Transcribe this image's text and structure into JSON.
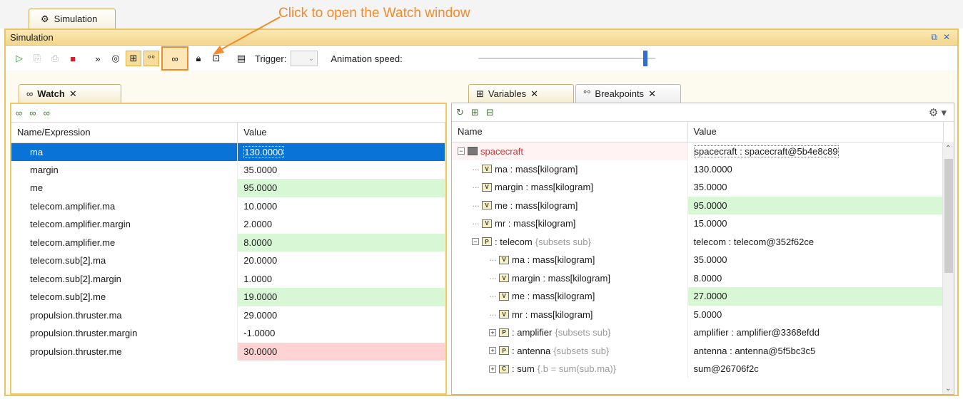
{
  "top_tab": {
    "label": "Simulation"
  },
  "annotation": {
    "text": "Click to open the Watch window"
  },
  "title_bar": {
    "title": "Simulation",
    "restore": "⧉",
    "close": "✕"
  },
  "toolbar": {
    "trigger_label": "Trigger:",
    "animation_label": "Animation speed:"
  },
  "watch": {
    "tab_label": "Watch",
    "tab_close": "✕",
    "columns": [
      "Name/Expression",
      "Value"
    ],
    "rows": [
      {
        "name": "ma",
        "value": "130.0000"
      },
      {
        "name": "margin",
        "value": "35.0000"
      },
      {
        "name": "me",
        "value": "95.0000"
      },
      {
        "name": "telecom.amplifier.ma",
        "value": "10.0000"
      },
      {
        "name": "telecom.amplifier.margin",
        "value": "2.0000"
      },
      {
        "name": "telecom.amplifier.me",
        "value": "8.0000"
      },
      {
        "name": "telecom.sub[2].ma",
        "value": "20.0000"
      },
      {
        "name": "telecom.sub[2].margin",
        "value": "1.0000"
      },
      {
        "name": "telecom.sub[2].me",
        "value": "19.0000"
      },
      {
        "name": "propulsion.thruster.ma",
        "value": "29.0000"
      },
      {
        "name": "propulsion.thruster.margin",
        "value": "-1.0000"
      },
      {
        "name": "propulsion.thruster.me",
        "value": "30.0000"
      }
    ]
  },
  "variables": {
    "tab_label": "Variables",
    "tab_close": "✕",
    "breakpoints_label": "Breakpoints",
    "breakpoints_close": "✕",
    "columns": [
      "Name",
      "Value"
    ],
    "rows": [
      {
        "name": "spacecraft",
        "sub": "",
        "value": "spacecraft : spacecraft@5b4e8c89"
      },
      {
        "name": "ma : mass[kilogram]",
        "sub": "",
        "value": "130.0000"
      },
      {
        "name": "margin : mass[kilogram]",
        "sub": "",
        "value": "35.0000"
      },
      {
        "name": "me : mass[kilogram]",
        "sub": "",
        "value": "95.0000"
      },
      {
        "name": "mr : mass[kilogram]",
        "sub": "",
        "value": "15.0000"
      },
      {
        "name": ": telecom",
        "sub": "{subsets sub}",
        "value": "telecom : telecom@352f62ce"
      },
      {
        "name": "ma : mass[kilogram]",
        "sub": "",
        "value": "35.0000"
      },
      {
        "name": "margin : mass[kilogram]",
        "sub": "",
        "value": "8.0000"
      },
      {
        "name": "me : mass[kilogram]",
        "sub": "",
        "value": "27.0000"
      },
      {
        "name": "mr : mass[kilogram]",
        "sub": "",
        "value": "5.0000"
      },
      {
        "name": ": amplifier",
        "sub": "{subsets sub}",
        "value": "amplifier : amplifier@3368efdd"
      },
      {
        "name": ": antenna",
        "sub": "{subsets sub}",
        "value": "antenna : antenna@5f5bc3c5"
      },
      {
        "name": ": sum",
        "sub": "{.b = sum(sub.ma)}",
        "value": "sum@26706f2c"
      }
    ]
  },
  "colors": {
    "accent_orange": "#f28a2e",
    "selection_blue": "#0a73d8",
    "highlight_green": "#d8f7d4",
    "highlight_red": "#ffd3d3"
  }
}
